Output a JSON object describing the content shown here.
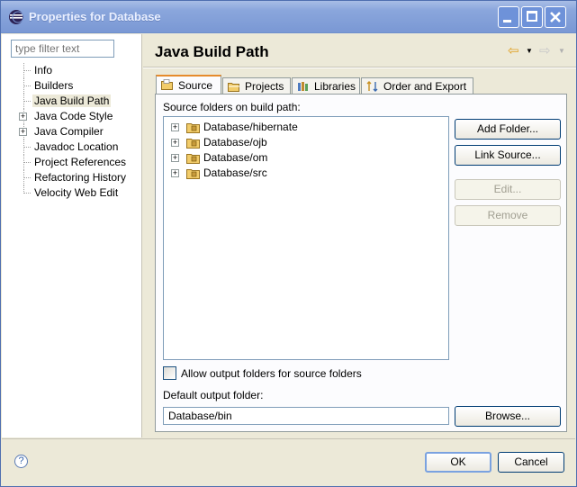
{
  "window": {
    "title": "Properties for Database"
  },
  "filter": {
    "placeholder": "type filter text"
  },
  "tree": {
    "items": [
      {
        "label": "Info",
        "expandable": false,
        "selected": false
      },
      {
        "label": "Builders",
        "expandable": false,
        "selected": false
      },
      {
        "label": "Java Build Path",
        "expandable": false,
        "selected": true
      },
      {
        "label": "Java Code Style",
        "expandable": true,
        "selected": false
      },
      {
        "label": "Java Compiler",
        "expandable": true,
        "selected": false
      },
      {
        "label": "Javadoc Location",
        "expandable": false,
        "selected": false
      },
      {
        "label": "Project References",
        "expandable": false,
        "selected": false
      },
      {
        "label": "Refactoring History",
        "expandable": false,
        "selected": false
      },
      {
        "label": "Velocity Web Edit",
        "expandable": false,
        "selected": false
      }
    ]
  },
  "page": {
    "title": "Java Build Path"
  },
  "tabs": [
    {
      "label": "Source",
      "icon": "source-folder-icon",
      "active": true
    },
    {
      "label": "Projects",
      "icon": "project-folder-icon",
      "active": false
    },
    {
      "label": "Libraries",
      "icon": "libraries-icon",
      "active": false
    },
    {
      "label": "Order and Export",
      "icon": "order-export-icon",
      "active": false
    }
  ],
  "source": {
    "list_label": "Source folders on build path:",
    "folders": [
      "Database/hibernate",
      "Database/ojb",
      "Database/om",
      "Database/src"
    ],
    "buttons": {
      "add_folder": "Add Folder...",
      "link_source": "Link Source...",
      "edit": "Edit...",
      "remove": "Remove"
    },
    "allow_output_label": "Allow output folders for source folders",
    "allow_output_checked": false,
    "default_output_label": "Default output folder:",
    "default_output_value": "Database/bin",
    "browse": "Browse..."
  },
  "dialog": {
    "ok": "OK",
    "cancel": "Cancel",
    "help_glyph": "?"
  },
  "colors": {
    "tab_accent": "#e68b2c",
    "title_bar": "#7a98d4",
    "folder": "#e8b84a"
  }
}
